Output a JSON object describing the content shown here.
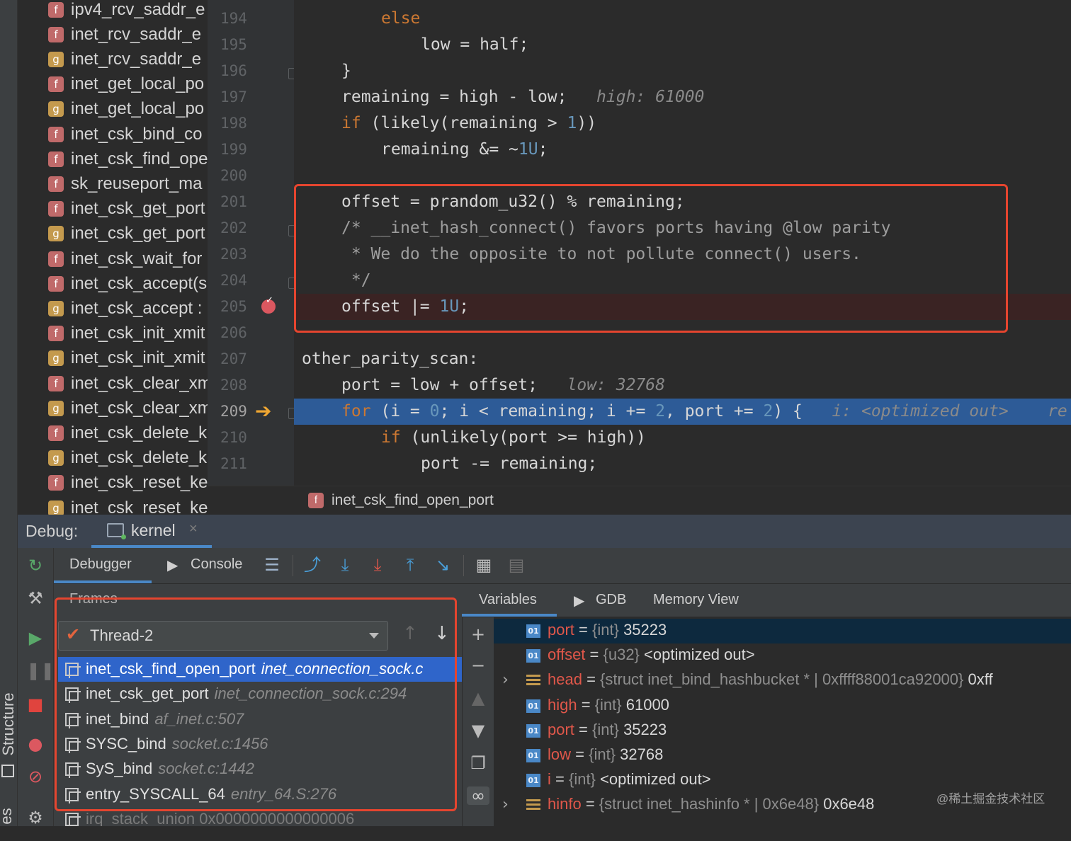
{
  "left_strip": {
    "structure_label": "Structure",
    "bottom_label": "es"
  },
  "structure_items": [
    {
      "icon": "f",
      "label": "ipv4_rcv_saddr_e",
      "locked": false
    },
    {
      "icon": "f",
      "label": "inet_rcv_saddr_e",
      "locked": false
    },
    {
      "icon": "g",
      "label": "inet_rcv_saddr_e",
      "locked": false
    },
    {
      "icon": "f",
      "label": "inet_get_local_po",
      "locked": false
    },
    {
      "icon": "g",
      "label": "inet_get_local_po",
      "locked": false
    },
    {
      "icon": "f",
      "label": "inet_csk_bind_co",
      "locked": true
    },
    {
      "icon": "f",
      "label": "inet_csk_find_ope",
      "locked": true
    },
    {
      "icon": "f",
      "label": "sk_reuseport_ma",
      "locked": true
    },
    {
      "icon": "f",
      "label": "inet_csk_get_port",
      "locked": false
    },
    {
      "icon": "g",
      "label": "inet_csk_get_port",
      "locked": false
    },
    {
      "icon": "f",
      "label": "inet_csk_wait_for",
      "locked": true
    },
    {
      "icon": "f",
      "label": "inet_csk_accept(s",
      "locked": false
    },
    {
      "icon": "g",
      "label": "inet_csk_accept :",
      "locked": false
    },
    {
      "icon": "f",
      "label": "inet_csk_init_xmit",
      "locked": false
    },
    {
      "icon": "g",
      "label": "inet_csk_init_xmit",
      "locked": false
    },
    {
      "icon": "f",
      "label": "inet_csk_clear_xm",
      "locked": false
    },
    {
      "icon": "g",
      "label": "inet_csk_clear_xm",
      "locked": false
    },
    {
      "icon": "f",
      "label": "inet_csk_delete_k",
      "locked": false
    },
    {
      "icon": "g",
      "label": "inet_csk_delete_k",
      "locked": false
    },
    {
      "icon": "f",
      "label": "inet_csk_reset_ke",
      "locked": false
    },
    {
      "icon": "g",
      "label": "inet_csk_reset_ke",
      "locked": false
    }
  ],
  "editor": {
    "line_numbers": [
      "194",
      "195",
      "196",
      "197",
      "198",
      "199",
      "200",
      "201",
      "202",
      "203",
      "204",
      "205",
      "206",
      "207",
      "208",
      "209",
      "210",
      "211"
    ],
    "current_line": "209",
    "breakpoint_line": "205",
    "code": {
      "l194_kw": "else",
      "l195": "low = half;",
      "l196": "}",
      "l197": "remaining = high - low;",
      "l197_hint": "high: 61000",
      "l198_kw": "if",
      "l198_a": " (likely(remaining > ",
      "l198_num": "1",
      "l198_b": "))",
      "l199_a": "remaining &= ~",
      "l199_num": "1U",
      "l199_b": ";",
      "l201": "offset = prandom_u32() % remaining;",
      "l202": "/* __inet_hash_connect() favors ports having @low parity",
      "l203": " * We do the opposite to not pollute connect() users.",
      "l204": " */",
      "l205_a": "offset |= ",
      "l205_num": "1U",
      "l205_b": ";",
      "l207": "other_parity_scan:",
      "l208": "port = low + offset;",
      "l208_hint": "low: 32768",
      "l209_kw": "for",
      "l209_a": " (i = ",
      "l209_n1": "0",
      "l209_b": "; i < remaining; i += ",
      "l209_n2": "2",
      "l209_c": ", port += ",
      "l209_n3": "2",
      "l209_d": ") {",
      "l209_hint": "i: <optimized out>",
      "l209_hint2": "re",
      "l210_kw": "if",
      "l210_a": " (unlikely(port >= high))",
      "l211": "port -= remaining;"
    }
  },
  "breadcrumb": {
    "function": "inet_csk_find_open_port"
  },
  "debug": {
    "label": "Debug:",
    "session_tab": "kernel",
    "tabs": {
      "debugger": "Debugger",
      "console": "Console"
    }
  },
  "frames": {
    "title": "Frames",
    "thread": "Thread-2",
    "items": [
      {
        "fn": "inet_csk_find_open_port",
        "loc": "inet_connection_sock.c",
        "selected": true
      },
      {
        "fn": "inet_csk_get_port",
        "loc": "inet_connection_sock.c:294",
        "selected": false
      },
      {
        "fn": "inet_bind",
        "loc": "af_inet.c:507",
        "selected": false
      },
      {
        "fn": "SYSC_bind",
        "loc": "socket.c:1456",
        "selected": false
      },
      {
        "fn": "SyS_bind",
        "loc": "socket.c:1442",
        "selected": false
      },
      {
        "fn": "entry_SYSCALL_64",
        "loc": "entry_64.S:276",
        "selected": false
      },
      {
        "fn": "irq_stack_union 0x0000000000000006",
        "loc": "",
        "selected": false
      }
    ]
  },
  "variables_tabs": {
    "variables": "Variables",
    "gdb": "GDB",
    "memory": "Memory View"
  },
  "variables": [
    {
      "name": "port",
      "type": "{int}",
      "value": "35223",
      "kind": "prim",
      "expandable": false,
      "selected": true
    },
    {
      "name": "offset",
      "type": "{u32}",
      "value": "<optimized out>",
      "kind": "prim",
      "expandable": false,
      "selected": false
    },
    {
      "name": "head",
      "type": "{struct inet_bind_hashbucket * | 0xffff88001ca92000}",
      "value": "0xff",
      "kind": "struct",
      "expandable": true,
      "selected": false
    },
    {
      "name": "high",
      "type": "{int}",
      "value": "61000",
      "kind": "prim",
      "expandable": false,
      "selected": false
    },
    {
      "name": "port",
      "type": "{int}",
      "value": "35223",
      "kind": "prim",
      "expandable": false,
      "selected": false
    },
    {
      "name": "low",
      "type": "{int}",
      "value": "32768",
      "kind": "prim",
      "expandable": false,
      "selected": false
    },
    {
      "name": "i",
      "type": "{int}",
      "value": "<optimized out>",
      "kind": "prim",
      "expandable": false,
      "selected": false
    },
    {
      "name": "hinfo",
      "type": "{struct inet_hashinfo * | 0x6e48}",
      "value": "0x6e48",
      "kind": "struct",
      "expandable": true,
      "selected": false
    }
  ],
  "var_icon_text": "01",
  "watermark": "@稀土掘金技术社区",
  "colors": {
    "highlight_box": "#e5452f",
    "selection": "#2f65ca",
    "exec_line": "#2d5b97",
    "keyword": "#cc7832",
    "number": "#6897bb"
  }
}
